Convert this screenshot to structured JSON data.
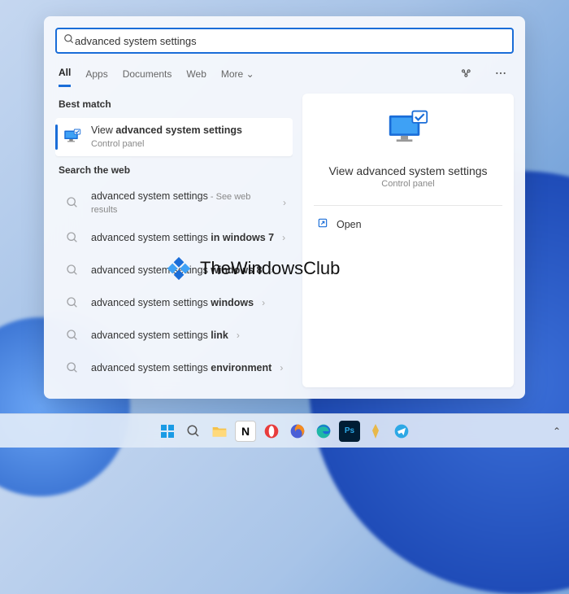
{
  "search": {
    "value": "advanced system settings"
  },
  "tabs": {
    "items": [
      "All",
      "Apps",
      "Documents",
      "Web",
      "More"
    ],
    "chevron": "⌄"
  },
  "sections": {
    "best_match": "Best match",
    "search_web": "Search the web"
  },
  "best_match": {
    "title_prefix": "View ",
    "title_bold": "advanced system settings",
    "subtitle": "Control panel"
  },
  "web_results": [
    {
      "normal": "advanced system settings",
      "suffix": " - See web results",
      "bold": ""
    },
    {
      "normal": "advanced system settings ",
      "suffix": "",
      "bold": "in windows 7"
    },
    {
      "normal": "advanced system settings ",
      "suffix": "",
      "bold": "windows 8"
    },
    {
      "normal": "advanced system settings ",
      "suffix": "",
      "bold": "windows"
    },
    {
      "normal": "advanced system settings ",
      "suffix": "",
      "bold": "link"
    },
    {
      "normal": "advanced system settings ",
      "suffix": "",
      "bold": "environment"
    }
  ],
  "detail": {
    "title": "View advanced system settings",
    "subtitle": "Control panel",
    "open": "Open"
  },
  "watermark": "TheWindowsClub",
  "taskbar": {
    "chevron": "⌃"
  }
}
